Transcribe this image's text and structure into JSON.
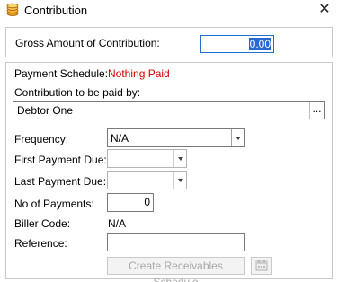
{
  "window": {
    "title": "Contribution",
    "close_glyph": "✕"
  },
  "gross": {
    "label": "Gross Amount of Contribution:",
    "value": "0.00"
  },
  "payment_schedule": {
    "label": "Payment Schedule:",
    "status": "Nothing Paid",
    "status_color": "#d40000"
  },
  "contribution_by": {
    "label": "Contribution to be paid by:",
    "value": "Debtor One",
    "browse_label": "..."
  },
  "frequency": {
    "label": "Frequency:",
    "value": "N/A"
  },
  "first_payment": {
    "label": "First Payment Due:",
    "value": ""
  },
  "last_payment": {
    "label": "Last Payment Due:",
    "value": ""
  },
  "num_payments": {
    "label": "No of Payments:",
    "value": "0"
  },
  "biller_code": {
    "label": "Biller Code:",
    "value": "N/A"
  },
  "reference": {
    "label": "Reference:",
    "value": ""
  },
  "create_button": {
    "label": "Create Receivables Schedule"
  },
  "icons": {
    "app": "coins-icon",
    "calendar": "calendar-icon"
  }
}
